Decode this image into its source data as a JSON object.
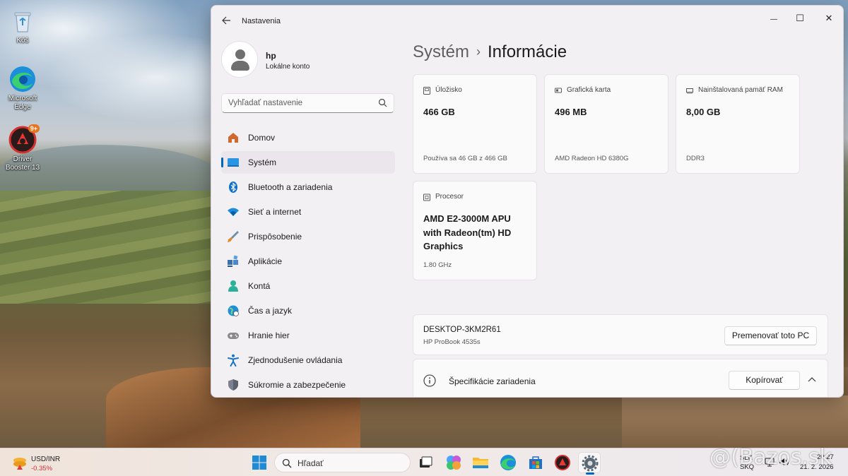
{
  "desktop": {
    "icons": [
      {
        "label": "Kôš",
        "icon": "recycle-bin-icon"
      },
      {
        "label": "Microsoft Edge",
        "icon": "edge-icon"
      },
      {
        "label": "Driver Booster 13",
        "icon": "driver-booster-icon",
        "badge": "9+"
      }
    ]
  },
  "window": {
    "title": "Nastavenia",
    "controls": {
      "minimize": "—",
      "maximize": "☐",
      "close": "✕"
    },
    "profile": {
      "name": "hp",
      "account": "Lokálne konto"
    },
    "search": {
      "placeholder": "Vyhľadať nastavenie"
    },
    "nav": [
      {
        "label": "Domov",
        "icon": "home-icon",
        "color": "#c4591e"
      },
      {
        "label": "Systém",
        "icon": "monitor-icon",
        "color": "#1f8ad6",
        "active": true
      },
      {
        "label": "Bluetooth a zariadenia",
        "icon": "bluetooth-icon",
        "color": "#0a6fd0"
      },
      {
        "label": "Sieť a internet",
        "icon": "wifi-icon",
        "color": "#1a8cd8"
      },
      {
        "label": "Prispôsobenie",
        "icon": "brush-icon",
        "color": "#d77b2a"
      },
      {
        "label": "Aplikácie",
        "icon": "apps-icon",
        "color": "#3a6fb0"
      },
      {
        "label": "Kontá",
        "icon": "accounts-icon",
        "color": "#2bb09a"
      },
      {
        "label": "Čas a jazyk",
        "icon": "globe-icon",
        "color": "#1b8fd9"
      },
      {
        "label": "Hranie hier",
        "icon": "gamepad-icon",
        "color": "#7a7a7a"
      },
      {
        "label": "Zjednodušenie ovládania",
        "icon": "accessibility-icon",
        "color": "#1674c9"
      },
      {
        "label": "Súkromie a zabezpečenie",
        "icon": "shield-icon",
        "color": "#6e7480"
      }
    ]
  },
  "main": {
    "breadcrumb": {
      "parent": "Systém",
      "separator": "›",
      "current": "Informácie"
    },
    "specs": [
      {
        "label": "Úložisko",
        "icon": "storage-icon",
        "value": "466 GB",
        "sub": "Používa sa 46 GB z 466 GB"
      },
      {
        "label": "Grafická karta",
        "icon": "gpu-icon",
        "value": "496 MB",
        "sub": "AMD Radeon HD 6380G"
      },
      {
        "label": "Nainštalovaná pamäť RAM",
        "icon": "ram-icon",
        "value": "8,00 GB",
        "sub": "DDR3"
      },
      {
        "label": "Procesor",
        "icon": "cpu-icon",
        "value": "AMD E2-3000M APU with Radeon(tm) HD Graphics",
        "sub": "1.80 GHz"
      }
    ],
    "device": {
      "name": "DESKTOP-3KM2R61",
      "model": "HP ProBook 4535s",
      "rename_button": "Premenovať toto PC"
    },
    "specs_section": {
      "title": "Špecifikácie zariadenia",
      "copy_button": "Kopírovať"
    }
  },
  "taskbar": {
    "widget": {
      "title": "USD/INR",
      "change": "-0.35%"
    },
    "search_label": "Hľadať",
    "language": {
      "line1": "SLK",
      "line2": "SKQ"
    },
    "clock": {
      "time": "20:27",
      "date": "21. 2. 2026"
    },
    "watermark": "@(Bazos.sk"
  },
  "colors": {
    "accent": "#0067c0",
    "negative": "#d13438"
  }
}
